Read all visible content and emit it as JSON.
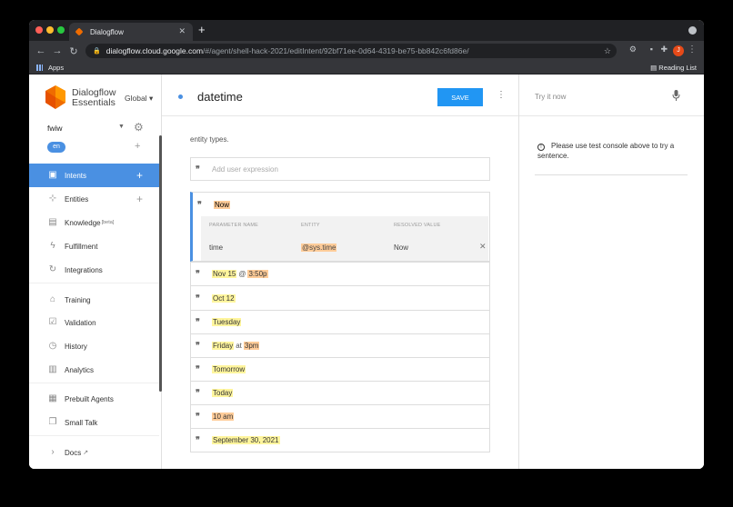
{
  "browser": {
    "tab_title": "Dialogflow",
    "url_host": "dialogflow.cloud.google.com",
    "url_path": "/#/agent/shell-hack-2021/editIntent/92bf71ee-0d64-4319-be75-bb842c6fd86e/",
    "apps_label": "Apps",
    "reading_list": "Reading List",
    "avatar_initial": "J"
  },
  "sidebar": {
    "brand_line1": "Dialogflow",
    "brand_line2": "Essentials",
    "region": "Global",
    "agent": "fwiw",
    "language": "en",
    "items": [
      {
        "label": "Intents"
      },
      {
        "label": "Entities"
      },
      {
        "label": "Knowledge",
        "badge": "[beta]"
      },
      {
        "label": "Fulfillment"
      },
      {
        "label": "Integrations"
      },
      {
        "label": "Training"
      },
      {
        "label": "Validation"
      },
      {
        "label": "History"
      },
      {
        "label": "Analytics"
      },
      {
        "label": "Prebuilt Agents"
      },
      {
        "label": "Small Talk"
      },
      {
        "label": "Docs"
      }
    ]
  },
  "main": {
    "intent_name": "datetime",
    "save_label": "SAVE",
    "help_text": "entity types.",
    "add_placeholder": "Add user expression",
    "expanded_phrase": "Now",
    "param_headers": {
      "name": "PARAMETER NAME",
      "entity": "ENTITY",
      "resolved": "RESOLVED VALUE"
    },
    "param_row": {
      "name": "time",
      "entity": "@sys.time",
      "resolved": "Now"
    },
    "phrases": [
      {
        "p1": "Nov 15",
        "sep": "@",
        "p2": "3:50p"
      },
      {
        "p1": "Oct 12"
      },
      {
        "p1": "Tuesday"
      },
      {
        "p1": "Friday",
        "sep": "at",
        "p2": "3pm"
      },
      {
        "p1": "Tomorrow"
      },
      {
        "p1": "Today"
      },
      {
        "p1": "10 am"
      },
      {
        "p1": "September 30, 2021"
      }
    ]
  },
  "right": {
    "try_placeholder": "Try it now",
    "info": "Please use test console above to try a sentence."
  },
  "colors": {
    "accent": "#4a90e2",
    "save": "#2196f3",
    "highlight_orange": "#ffcc99",
    "highlight_yellow": "#fff59d"
  }
}
